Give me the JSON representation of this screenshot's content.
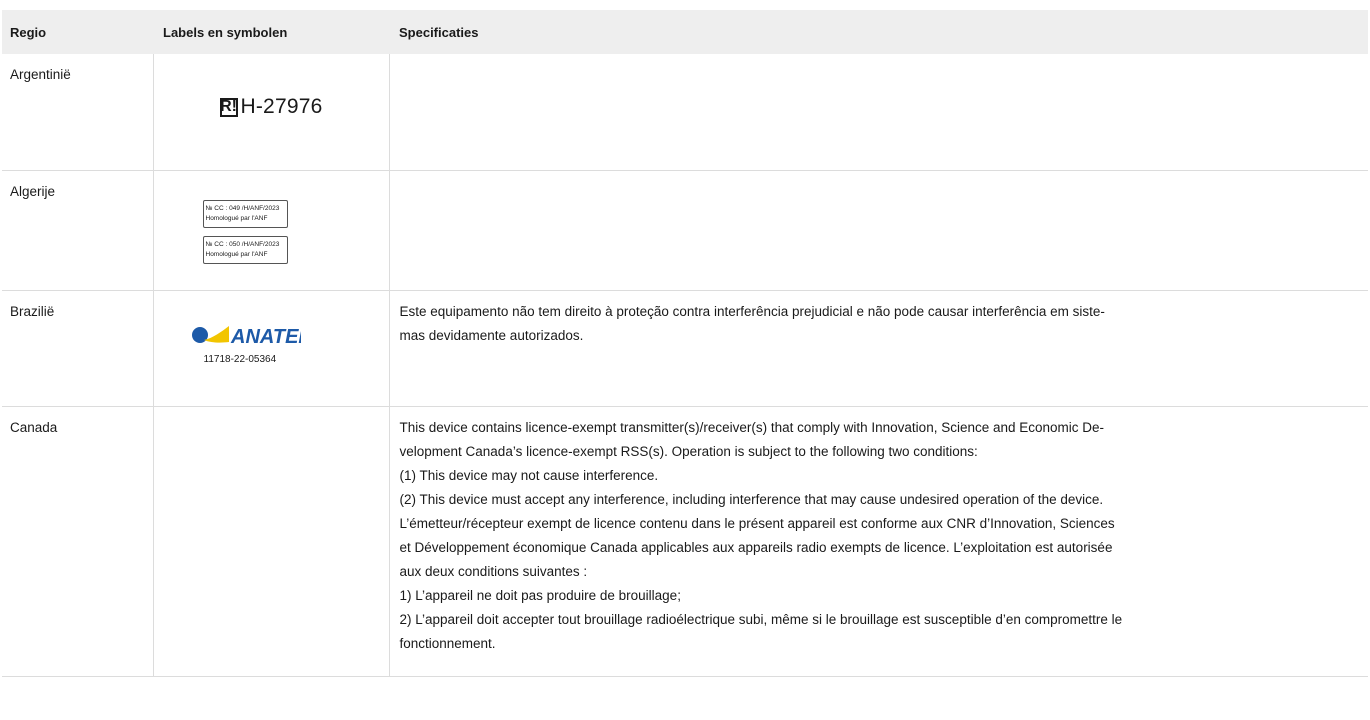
{
  "table": {
    "headers": [
      "Regio",
      "Labels en symbolen",
      "Specificaties"
    ],
    "rows": [
      {
        "region": "Argentinië",
        "label": {
          "symbol": "R!",
          "code": "H-27976"
        },
        "spec": []
      },
      {
        "region": "Algerije",
        "label": {
          "boxes": [
            {
              "line1": "№ CC : 049 /H/ANF/2023",
              "line2": "Homologué par l'ANF"
            },
            {
              "line1": "№ CC : 050 /H/ANF/2023",
              "line2": "Homologué par l'ANF"
            }
          ]
        },
        "spec": []
      },
      {
        "region": "Brazilië",
        "label": {
          "logo_text": "ANATEL",
          "code": "11718-22-05364",
          "colors": {
            "yellow": "#f2c500",
            "blue": "#1d5aa8"
          }
        },
        "spec": [
          "Este equipamento não tem direito à proteção contra interferência prejudicial e não pode causar interferência em siste-",
          "mas devidamente autorizados."
        ]
      },
      {
        "region": "Canada",
        "label": {},
        "spec": [
          "This device contains licence-exempt transmitter(s)/receiver(s) that comply with Innovation, Science and Economic De-",
          "velopment Canada’s licence-exempt RSS(s). Operation is subject to the following two conditions:",
          "(1) This device may not cause interference.",
          "(2) This device must accept any interference, including interference that may cause undesired operation of the device.",
          "L’émetteur/récepteur exempt de licence contenu dans le présent appareil est conforme aux CNR d’Innovation, Sciences",
          "et Développement économique Canada applicables aux appareils radio exempts de licence. L’exploitation est autorisée",
          "aux deux conditions suivantes :",
          "1) L’appareil ne doit pas produire de brouillage;",
          "2) L’appareil doit accepter tout brouillage radioélectrique subi, même si le brouillage est susceptible d’en compromettre le",
          "fonctionnement."
        ]
      }
    ]
  }
}
